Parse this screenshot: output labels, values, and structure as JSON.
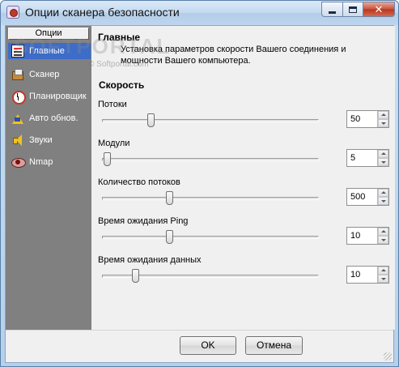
{
  "window": {
    "title": "Опции сканера безопасности",
    "close_glyph": "✕"
  },
  "sidebar": {
    "header": "Опции",
    "items": [
      {
        "label": "Главные",
        "icon": "main-settings-icon",
        "selected": true
      },
      {
        "label": "Сканер",
        "icon": "scanner-icon",
        "selected": false
      },
      {
        "label": "Планировщик",
        "icon": "scheduler-clock-icon",
        "selected": false
      },
      {
        "label": "Авто обнов.",
        "icon": "auto-update-icon",
        "selected": false
      },
      {
        "label": "Звуки",
        "icon": "sound-icon",
        "selected": false
      },
      {
        "label": "Nmap",
        "icon": "nmap-eye-icon",
        "selected": false
      }
    ]
  },
  "main": {
    "title": "Главные",
    "description": "Установка параметров скорости Вашего соединения и мощности Вашего компьютера.",
    "section_title": "Скорость",
    "fields": [
      {
        "label": "Потоки",
        "value": "50",
        "slider_level": 0.22
      },
      {
        "label": "Модули",
        "value": "5",
        "slider_level": 0.02
      },
      {
        "label": "Количество потоков",
        "value": "500",
        "slider_level": 0.31
      },
      {
        "label": "Время ожидания Ping",
        "value": "10",
        "slider_level": 0.31
      },
      {
        "label": "Время ожидания данных",
        "value": "10",
        "slider_level": 0.15
      }
    ]
  },
  "watermark": {
    "text": "SOFTPORTAL",
    "small": "© Softportal.com"
  },
  "footer": {
    "ok_label": "OK",
    "cancel_label": "Отмена"
  }
}
